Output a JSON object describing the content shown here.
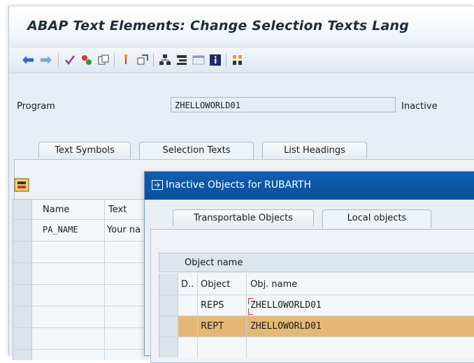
{
  "window": {
    "title": "ABAP Text Elements: Change Selection Texts Lang"
  },
  "toolbar": {
    "icons": [
      "back-arrow-icon",
      "forward-arrow-icon",
      "check-icon",
      "activate-icon",
      "copy-icon",
      "pin-icon",
      "where-used-icon",
      "hierarchy-icon",
      "tree-icon",
      "window-icon",
      "info-icon",
      "layout-icon"
    ]
  },
  "program_field": {
    "label": "Program",
    "value": "ZHELLOWORLD01",
    "status": "Inactive"
  },
  "main_tabs": [
    {
      "label": "Text Symbols"
    },
    {
      "label": "Selection Texts"
    },
    {
      "label": "List Headings"
    }
  ],
  "selection_grid": {
    "headers": {
      "name": "Name",
      "text": "Text"
    },
    "rows": [
      {
        "name": "PA_NAME",
        "text": "Your na"
      }
    ]
  },
  "dialog": {
    "title": "Inactive Objects for RUBARTH",
    "tabs": [
      {
        "label": "Transportable Objects"
      },
      {
        "label": "Local objects"
      }
    ],
    "tree_header": "Object name",
    "columns": {
      "d": "D..",
      "object": "Object",
      "obj_name": "Obj. name"
    },
    "rows": [
      {
        "object": "REPS",
        "obj_name": "ZHELLOWORLD01"
      },
      {
        "object": "REPT",
        "obj_name": "ZHELLOWORLD01"
      }
    ],
    "highlight_color": "#e5b975"
  },
  "colors": {
    "title_bar_dialog": "#0f5fb4",
    "highlight_row": "#e5b975"
  }
}
